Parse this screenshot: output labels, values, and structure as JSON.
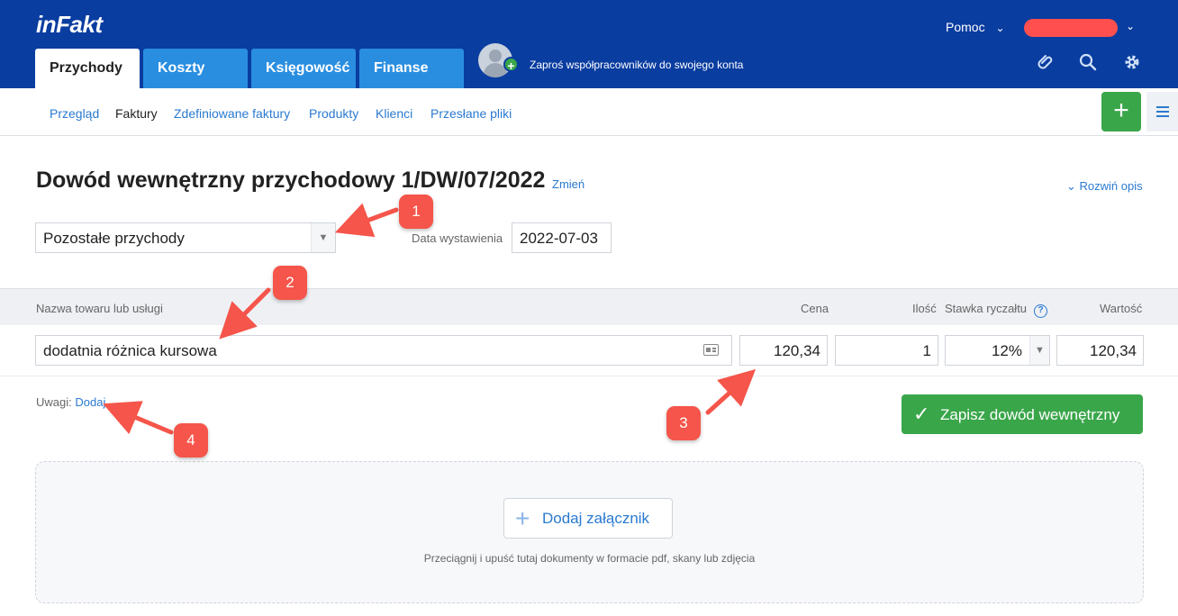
{
  "app": {
    "logo": "inFakt",
    "help_label": "Pomoc",
    "invite_text": "Zaproś współpracowników do swojego konta"
  },
  "main_tabs": [
    {
      "label": "Przychody",
      "active": true
    },
    {
      "label": "Koszty",
      "active": false
    },
    {
      "label": "Księgowość",
      "active": false
    },
    {
      "label": "Finanse",
      "active": false
    }
  ],
  "subnav": [
    {
      "label": "Przegląd",
      "current": false
    },
    {
      "label": "Faktury",
      "current": true
    },
    {
      "label": "Zdefiniowane faktury",
      "current": false
    },
    {
      "label": "Produkty",
      "current": false
    },
    {
      "label": "Klienci",
      "current": false
    },
    {
      "label": "Przesłane pliki",
      "current": false
    }
  ],
  "document": {
    "title": "Dowód wewnętrzny przychodowy 1/DW/07/2022",
    "change_link": "Zmień",
    "expand_description": "Rozwiń opis",
    "category": "Pozostałe przychody",
    "date_label": "Data wystawienia",
    "date_value": "2022-07-03"
  },
  "items_table": {
    "headers": {
      "name": "Nazwa towaru lub usługi",
      "price": "Cena",
      "quantity": "Ilość",
      "rate": "Stawka ryczałtu",
      "value": "Wartość"
    },
    "rows": [
      {
        "name": "dodatnia różnica kursowa",
        "price": "120,34",
        "quantity": "1",
        "rate": "12%",
        "value": "120,34"
      }
    ]
  },
  "notes": {
    "label": "Uwagi:",
    "add_link": "Dodaj"
  },
  "save_button": "Zapisz dowód wewnętrzny",
  "attachments": {
    "button": "Dodaj załącznik",
    "hint": "Przeciągnij i upuść tutaj dokumenty w formacie pdf, skany lub zdjęcia"
  },
  "annotations": [
    "1",
    "2",
    "3",
    "4"
  ],
  "colors": {
    "header_bg": "#0a3da0",
    "tab_bg": "#2a8ee0",
    "link": "#2a7ad0",
    "primary_green": "#3aa64a",
    "annotation_red": "#f5554a"
  },
  "icons": [
    "chevron-down-icon",
    "paperclip-icon",
    "search-icon",
    "gear-icon",
    "plus-icon",
    "menu-icon",
    "help-icon",
    "contact-card-icon",
    "check-icon"
  ]
}
